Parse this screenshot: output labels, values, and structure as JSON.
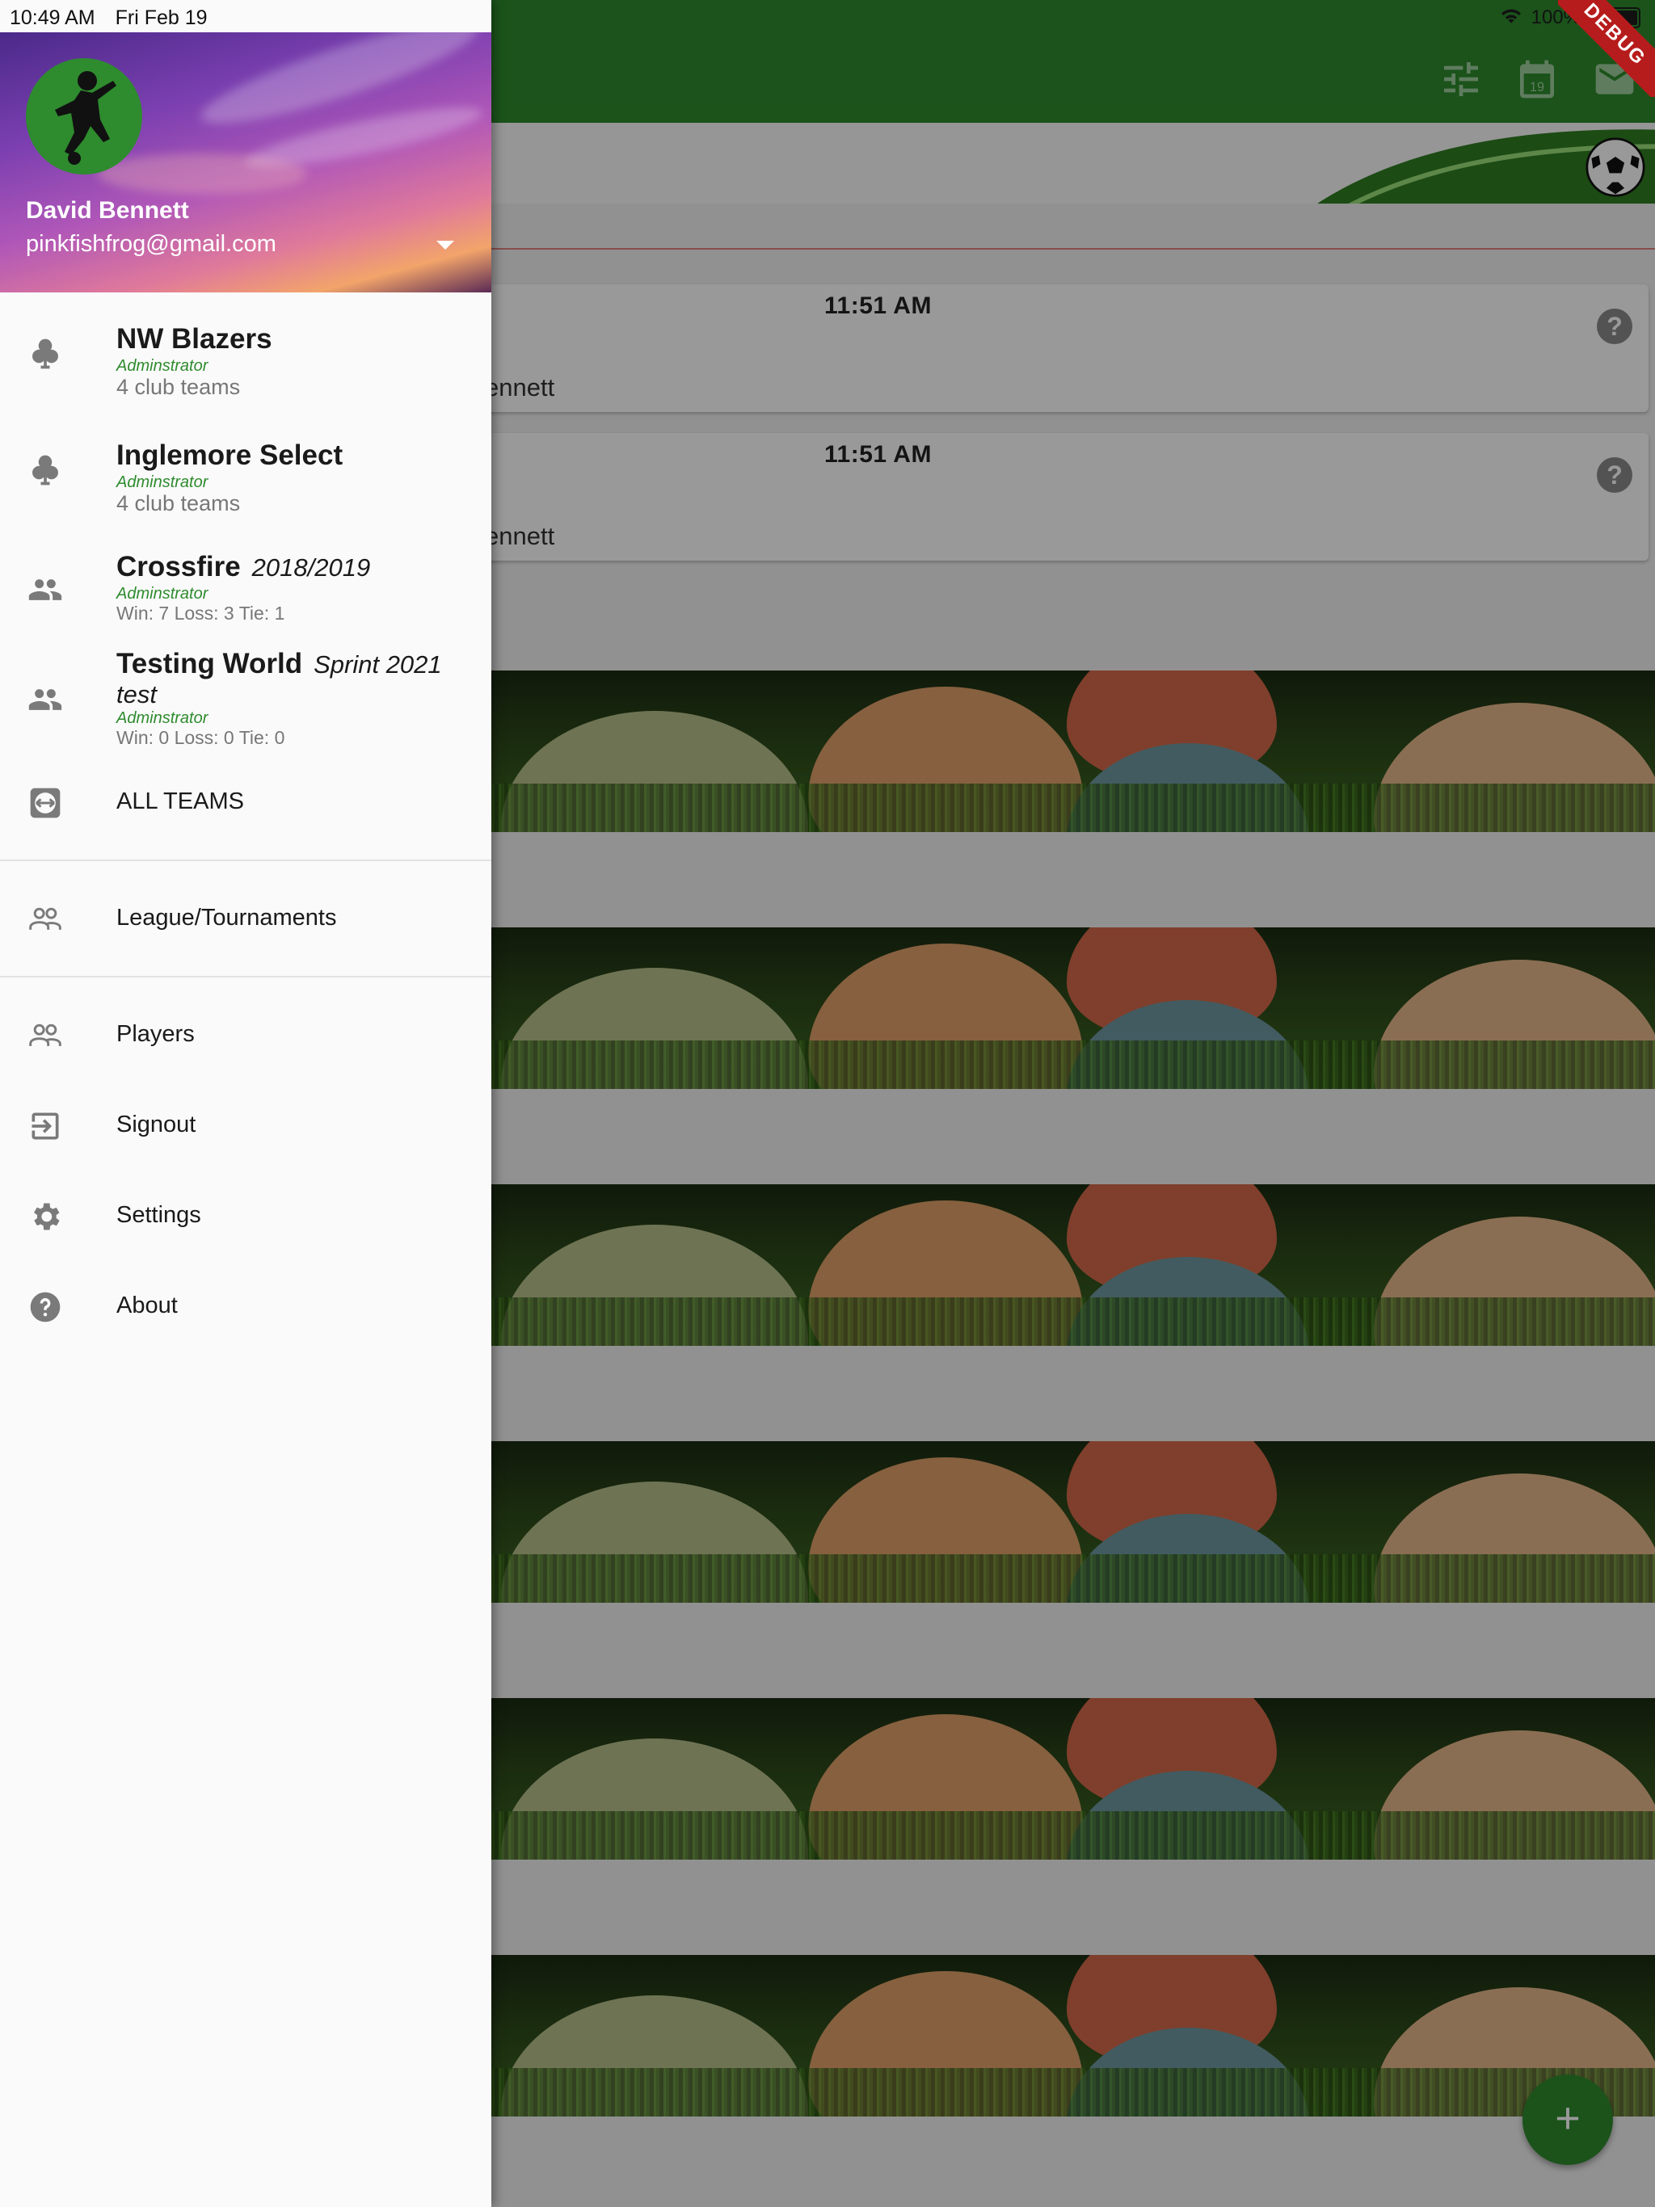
{
  "status_bar": {
    "time": "10:49 AM",
    "date": "Fri Feb 19",
    "battery": "100%",
    "debug_banner": "DEBUG"
  },
  "drawer": {
    "user_name": "David Bennett",
    "user_email": "pinkfishfrog@gmail.com",
    "clubs": [
      {
        "name": "NW Blazers",
        "role": "Adminstrator",
        "detail": "4 club teams",
        "icon": "club-icon"
      },
      {
        "name": "Inglemore Select",
        "role": "Adminstrator",
        "detail": "4 club teams",
        "icon": "club-icon"
      }
    ],
    "teams": [
      {
        "name": "Crossfire",
        "season": "2018/2019",
        "role": "Adminstrator",
        "record": "Win: 7 Loss: 3 Tie: 1",
        "icon": "people-icon"
      },
      {
        "name": "Testing World",
        "season": "Sprint 2021",
        "season_line2": "test",
        "role": "Adminstrator",
        "record": "Win: 0 Loss: 0 Tie: 0",
        "icon": "people-icon"
      }
    ],
    "all_teams_label": "ALL TEAMS",
    "league_label": "League/Tournaments",
    "players_label": "Players",
    "signout_label": "Signout",
    "settings_label": "Settings",
    "about_label": "About"
  },
  "background": {
    "games": [
      {
        "time": "11:51 AM",
        "who": "ennett"
      },
      {
        "time": "11:51 AM",
        "who": "ennett"
      }
    ],
    "fab_label": "+",
    "calendar_day": "19"
  },
  "colors": {
    "primary_green": "#2e8b2e",
    "drawer_bg": "#fafafa",
    "role_green": "#2e8b2e"
  }
}
